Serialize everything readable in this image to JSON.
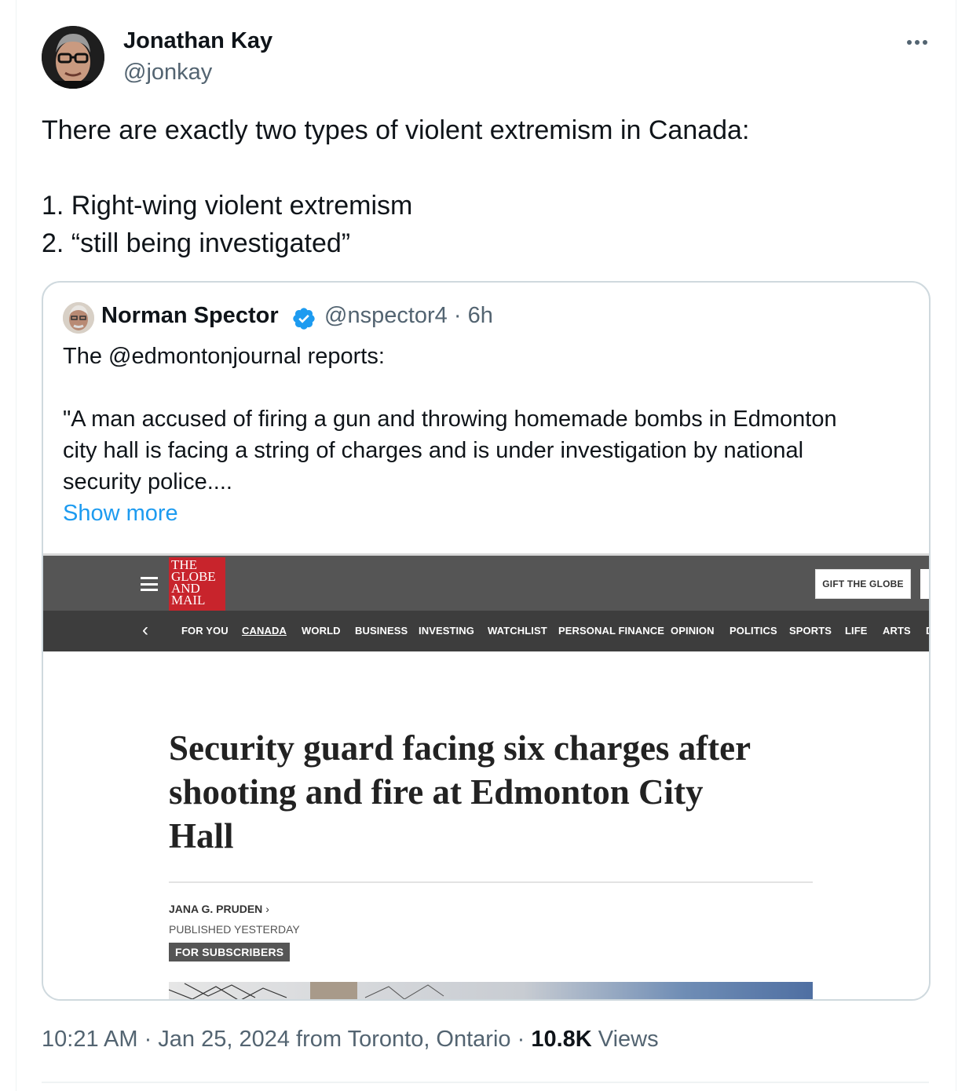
{
  "tweet": {
    "author_name": "Jonathan Kay",
    "author_handle": "@jonkay",
    "more_icon": "more-horizontal-icon",
    "text_lines": [
      "There are exactly two types of violent extremism in Canada:",
      "",
      "1. Right-wing violent extremism",
      "2. “still being investigated”"
    ],
    "timestamp": "10:21 AM · Jan 25, 2024 from Toronto, Ontario · ",
    "views_count": "10.8K",
    "views_label": " Views"
  },
  "quote": {
    "author_name": "Norman Spector",
    "verified_icon": "verified-badge-icon",
    "handle_time": "@nspector4 · 6h",
    "text_lines": [
      "The @edmontonjournal reports:",
      "",
      "\"A man accused of firing a gun and throwing homemade bombs in Edmonton",
      "city hall is facing a string of charges and is under investigation by national",
      "security police...."
    ],
    "show_more": "Show more"
  },
  "article": {
    "logo_lines": [
      "THE",
      "GLOBE",
      "AND",
      "MAIL"
    ],
    "gift_button": "GIFT THE GLOBE",
    "nav_items": [
      {
        "label": "FOR YOU",
        "active": false
      },
      {
        "label": "CANADA",
        "active": true
      },
      {
        "label": "WORLD",
        "active": false
      },
      {
        "label": "BUSINESS",
        "active": false
      },
      {
        "label": "INVESTING",
        "active": false
      },
      {
        "label": "WATCHLIST",
        "active": false
      },
      {
        "label": "PERSONAL FINANCE",
        "active": false
      },
      {
        "label": "OPINION",
        "active": false
      },
      {
        "label": "POLITICS",
        "active": false
      },
      {
        "label": "SPORTS",
        "active": false
      },
      {
        "label": "LIFE",
        "active": false
      },
      {
        "label": "ARTS",
        "active": false
      },
      {
        "label": "D",
        "active": false
      }
    ],
    "headline_lines": [
      "Security guard facing six charges after",
      "shooting and fire at Edmonton City",
      "Hall"
    ],
    "byline": "JANA G. PRUDEN",
    "published": "PUBLISHED YESTERDAY",
    "badge": "FOR SUBSCRIBERS"
  },
  "colors": {
    "text_primary": "#0f1419",
    "text_secondary": "#536471",
    "link": "#1d9bf0",
    "verified": "#1d9bf0",
    "globe_red": "#c8242c",
    "globe_bar": "#555555",
    "globe_nav": "#3d3d3d"
  }
}
